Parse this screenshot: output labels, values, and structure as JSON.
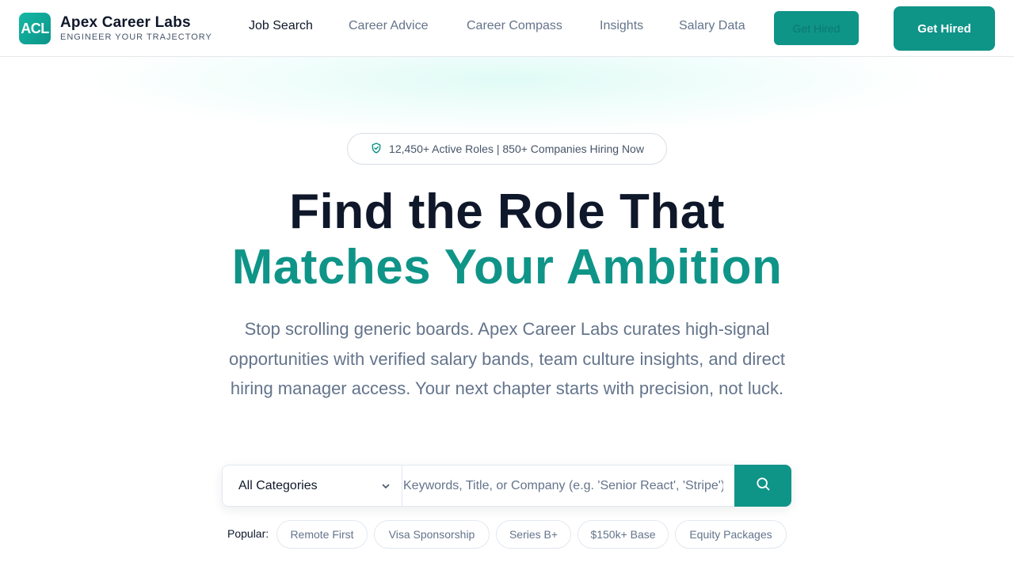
{
  "brand": {
    "mark": "ACL",
    "name": "Apex Career Labs",
    "tagline": "ENGINEER YOUR TRAJECTORY"
  },
  "nav": {
    "items": [
      {
        "label": "Job Search",
        "active": true
      },
      {
        "label": "Career Advice",
        "active": false
      },
      {
        "label": "Career Compass",
        "active": false
      },
      {
        "label": "Insights",
        "active": false
      },
      {
        "label": "Salary Data",
        "active": false
      }
    ],
    "ghost_button": "Get Hired",
    "primary_button": "Get Hired"
  },
  "hero": {
    "badge_icon": "shield-check-icon",
    "badge_text": "12,450+ Active Roles | 850+ Companies Hiring Now",
    "title_line1": "Find the Role That",
    "title_line2": "Matches Your Ambition",
    "lead": "Stop scrolling generic boards. Apex Career Labs curates high-signal opportunities with verified salary bands, team culture insights, and direct hiring manager access. Your next chapter starts with precision, not luck."
  },
  "search": {
    "category_value": "All Categories",
    "keyword_placeholder": "Keywords, Title, or Company (e.g. 'Senior React', 'Stripe')",
    "button_icon": "search-icon"
  },
  "popular": {
    "label": "Popular:",
    "tags": [
      "Remote First",
      "Visa Sponsorship",
      "Series B+",
      "$150k+ Base",
      "Equity Packages"
    ]
  },
  "colors": {
    "accent": "#0f9488",
    "heading": "#0f172a",
    "muted": "#64748b"
  }
}
